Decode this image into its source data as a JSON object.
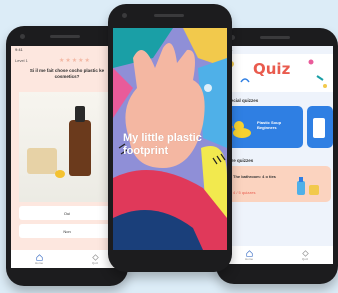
{
  "left_phone": {
    "status_time": "9:41",
    "status_right": "•••",
    "level": "Level 1",
    "stars": "★★★★★",
    "question": "Si il me fait chose cocho plastic ke cosmetics?",
    "answers": [
      "Oui",
      "Non"
    ],
    "nav": [
      "Home",
      "Quiz"
    ]
  },
  "middle_phone": {
    "title": "My little plastic footprint"
  },
  "right_phone": {
    "status_time": "9:41",
    "header_title": "Quiz",
    "section_special": "Special quizzes",
    "card_blue_text": "Plastic Soup Beginners",
    "section_more": "More quizzes",
    "card_peach_text": "The bathroom: 4 o ties",
    "card_peach_sub": "4 / 5 quizzes",
    "nav": [
      "Home",
      "Quiz"
    ]
  },
  "colors": {
    "background": "#dcecf7",
    "accent_red": "#e95b4e",
    "accent_blue": "#2f7fe3",
    "peach": "#fbd3bf"
  }
}
